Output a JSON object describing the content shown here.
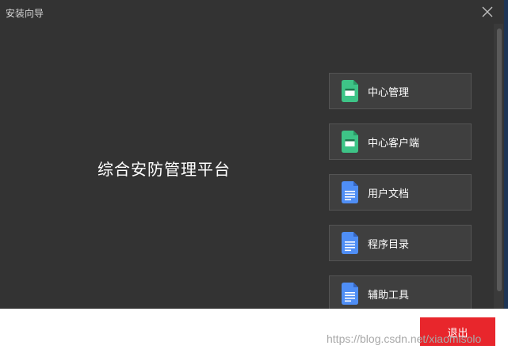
{
  "window": {
    "title": "安装向导"
  },
  "main": {
    "title": "综合安防管理平台"
  },
  "menu": [
    {
      "label": "中心管理",
      "icon": "app-window-icon",
      "color": "#3ec487"
    },
    {
      "label": "中心客户端",
      "icon": "app-window-icon",
      "color": "#3ec487"
    },
    {
      "label": "用户文档",
      "icon": "document-icon",
      "color": "#4f8ef5"
    },
    {
      "label": "程序目录",
      "icon": "document-icon",
      "color": "#4f8ef5"
    },
    {
      "label": "辅助工具",
      "icon": "document-icon",
      "color": "#4f8ef5"
    }
  ],
  "footer": {
    "exit_label": "退出",
    "exit_color": "#e8262c"
  },
  "watermark": "https://blog.csdn.net/xiaomisolo"
}
